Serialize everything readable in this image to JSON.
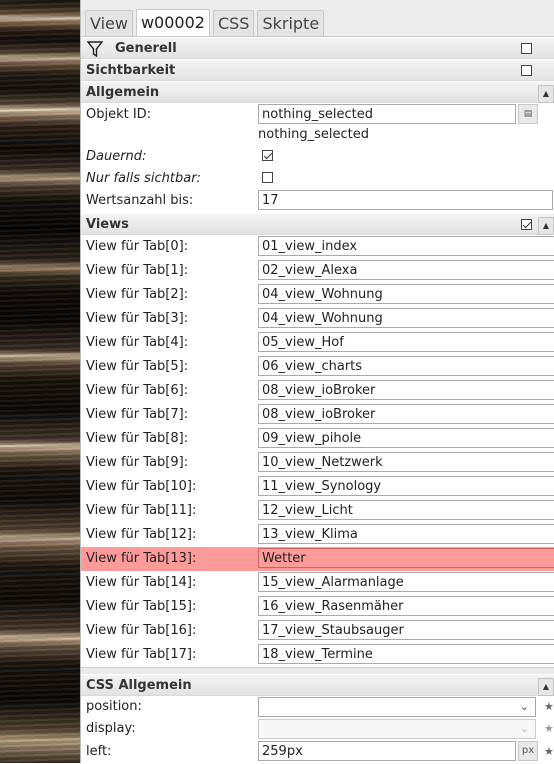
{
  "tabs": [
    "View",
    "w00002",
    "CSS",
    "Skripte"
  ],
  "sections": {
    "generell": "Generell",
    "sichtbarkeit": "Sichtbarkeit",
    "allgemein": "Allgemein",
    "views": "Views",
    "css_allgemein": "CSS Allgemein"
  },
  "allgemein": {
    "objekt_id_label": "Objekt ID:",
    "objekt_id_value": "nothing_selected",
    "objekt_id_hint": "nothing_selected",
    "dauernd_label": "Dauernd:",
    "dauernd_checked": true,
    "nur_falls_label": "Nur falls sichtbar:",
    "nur_falls_checked": false,
    "wertsanzahl_label": "Wertsanzahl bis:",
    "wertsanzahl_value": "17"
  },
  "views": [
    {
      "label": "View für Tab[0]:",
      "value": "01_view_index"
    },
    {
      "label": "View für Tab[1]:",
      "value": "02_view_Alexa"
    },
    {
      "label": "View für Tab[2]:",
      "value": "04_view_Wohnung"
    },
    {
      "label": "View für Tab[3]:",
      "value": "04_view_Wohnung"
    },
    {
      "label": "View für Tab[4]:",
      "value": "05_view_Hof"
    },
    {
      "label": "View für Tab[5]:",
      "value": "06_view_charts"
    },
    {
      "label": "View für Tab[6]:",
      "value": "08_view_ioBroker"
    },
    {
      "label": "View für Tab[7]:",
      "value": "08_view_ioBroker"
    },
    {
      "label": "View für Tab[8]:",
      "value": "09_view_pihole"
    },
    {
      "label": "View für Tab[9]:",
      "value": "10_view_Netzwerk"
    },
    {
      "label": "View für Tab[10]:",
      "value": "11_view_Synology"
    },
    {
      "label": "View für Tab[11]:",
      "value": "12_view_Licht"
    },
    {
      "label": "View für Tab[12]:",
      "value": "13_view_Klima"
    },
    {
      "label": "View für Tab[13]:",
      "value": "Wetter"
    },
    {
      "label": "View für Tab[14]:",
      "value": "15_view_Alarmanlage"
    },
    {
      "label": "View für Tab[15]:",
      "value": "16_view_Rasenmäher"
    },
    {
      "label": "View für Tab[16]:",
      "value": "17_view_Staubsauger"
    },
    {
      "label": "View für Tab[17]:",
      "value": "18_view_Termine"
    }
  ],
  "highlighted_view_index": 13,
  "css": {
    "position_label": "position:",
    "display_label": "display:",
    "left_label": "left:",
    "left_value": "259px",
    "left_unit": "px"
  },
  "colors": {
    "highlight": "#fd9a9a"
  }
}
